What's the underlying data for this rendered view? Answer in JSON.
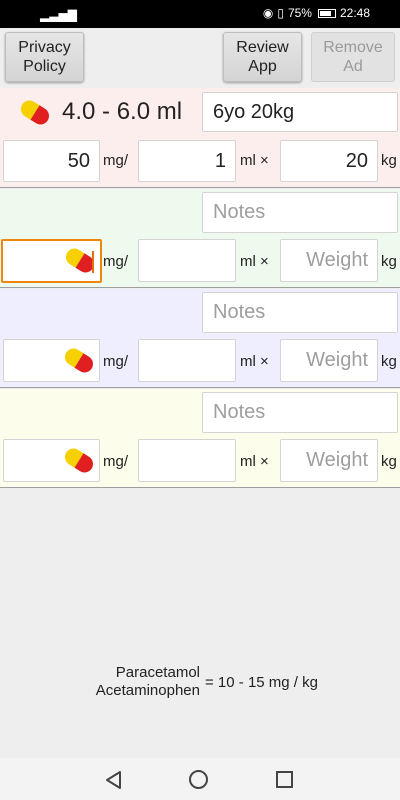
{
  "status_bar": {
    "battery": "75%",
    "time": "22:48",
    "signal": "signal-icon"
  },
  "toolbar": {
    "privacy_label": "Privacy\nPolicy",
    "review_label": "Review\nApp",
    "remove_ad_label": "Remove\nAd"
  },
  "panels": [
    {
      "result": "4.0 - 6.0 ml",
      "notes": "6yo 20kg",
      "mg": "50",
      "ml": "1",
      "weight": "20"
    },
    {
      "notes_placeholder": "Notes",
      "weight_placeholder": "Weight"
    },
    {
      "notes_placeholder": "Notes",
      "weight_placeholder": "Weight"
    },
    {
      "notes_placeholder": "Notes",
      "weight_placeholder": "Weight"
    }
  ],
  "units": {
    "mg": "mg/",
    "ml": "ml ×",
    "kg": "kg"
  },
  "formula": {
    "drug_name_1": "Paracetamol",
    "drug_name_2": "Acetaminophen",
    "equation": "= 10 - 15 mg / kg"
  },
  "colors": {
    "panel_1": "#fdeeee",
    "panel_2": "#eefaee",
    "panel_3": "#eeeeff",
    "panel_4": "#fcfdea",
    "focus": "#f0860a"
  }
}
